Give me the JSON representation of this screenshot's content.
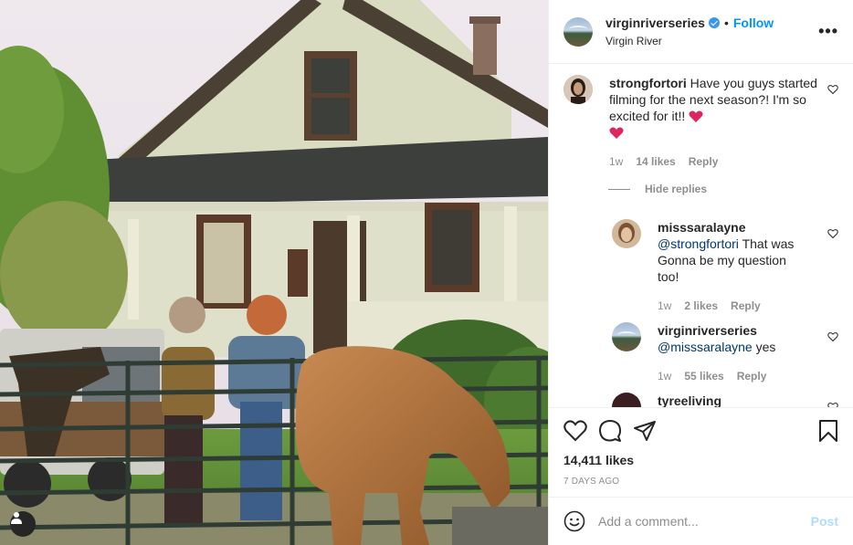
{
  "post": {
    "account": {
      "username": "virginriverseries",
      "verified": true,
      "location": "Virgin River",
      "follow_label": "Follow",
      "separator": "•"
    },
    "more_icon": "more-horizontal-icon",
    "photo": {
      "subject": "photo",
      "tag_icon": "user-tag-icon"
    },
    "comments": [
      {
        "username": "strongfortori",
        "text": "Have you guys started filming for the next season?! I'm so excited for it!!",
        "emoji": [
          "red-heart",
          "red-heart"
        ],
        "time": "1w",
        "likes": "14 likes",
        "reply_label": "Reply"
      },
      {
        "hide_replies": "Hide replies"
      },
      {
        "username": "misssaralayne",
        "mention": "@strongfortori",
        "text": "That was Gonna be my question too!",
        "time": "1w",
        "likes": "2 likes",
        "reply_label": "Reply"
      },
      {
        "username": "virginriverseries",
        "mention": "@misssaralayne",
        "text": "yes",
        "time": "1w",
        "likes": "55 likes",
        "reply_label": "Reply"
      },
      {
        "username": "tyreeliving"
      }
    ],
    "actions": {
      "like_icon": "heart-outline-icon",
      "comment_icon": "comment-icon",
      "share_icon": "paper-plane-icon",
      "save_icon": "bookmark-icon"
    },
    "likes": "14,411 likes",
    "posted_ago": "7 DAYS AGO",
    "add_comment": {
      "emoji_icon": "smiley-icon",
      "placeholder": "Add a comment...",
      "post_label": "Post"
    },
    "colors": {
      "link_blue": "#0095f6",
      "post_disabled": "#b3dbff",
      "muted": "#8e8e8e",
      "border": "#efefef"
    }
  }
}
